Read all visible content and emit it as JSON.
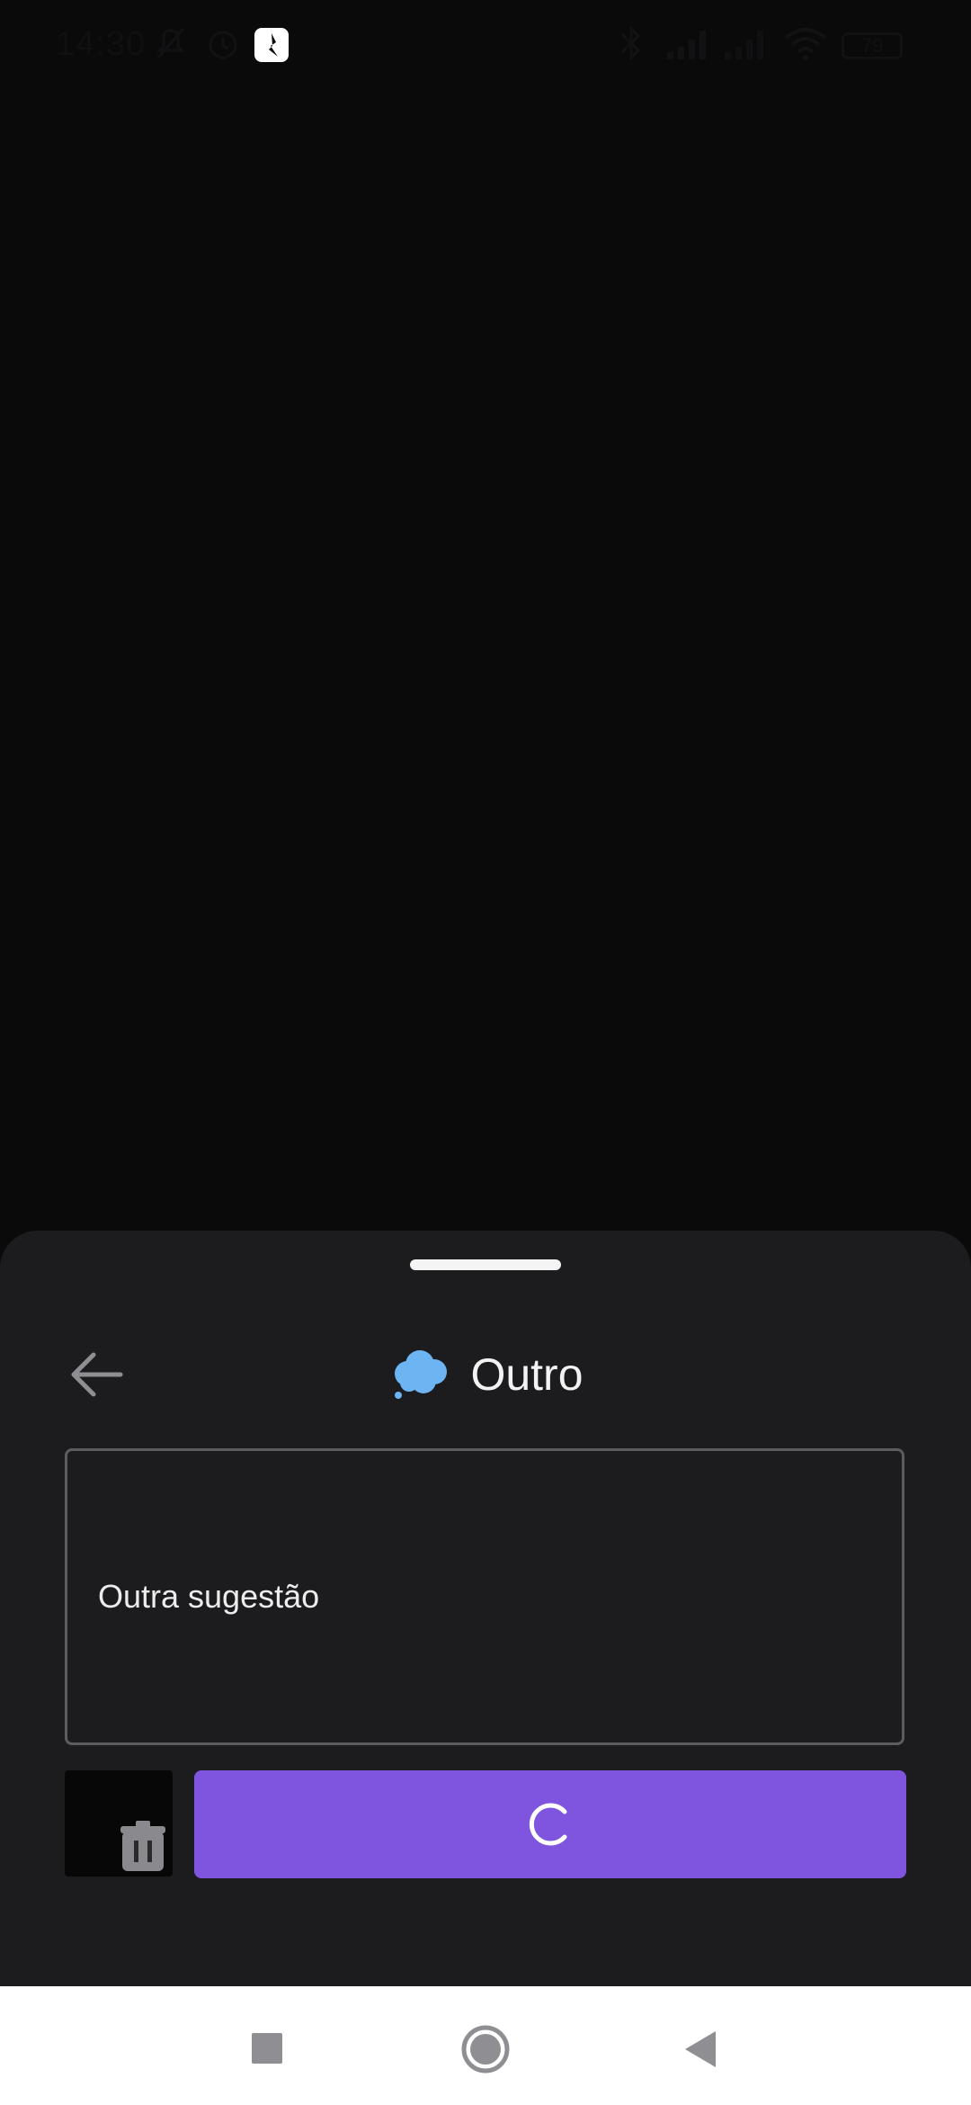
{
  "status_bar": {
    "time": "14:30",
    "battery": "79",
    "icons": [
      "mute-icon",
      "alarm-icon",
      "app-notification-icon",
      "bluetooth-icon",
      "signal-icon",
      "signal-2-icon",
      "wifi-icon",
      "battery-icon"
    ]
  },
  "sheet": {
    "title": "Outro",
    "title_icon": "thought-bubble-icon",
    "back_icon": "arrow-left-icon",
    "feedback_text": "Outra sugestão",
    "submit_state": "loading"
  },
  "navigation_bar": {
    "buttons": [
      "recent-apps-button",
      "home-button",
      "back-button"
    ]
  },
  "colors": {
    "background": "#0a0a0b",
    "sheet": "#1c1c1f",
    "accent": "#7f55e0",
    "bubble": "#6cb4f2"
  }
}
